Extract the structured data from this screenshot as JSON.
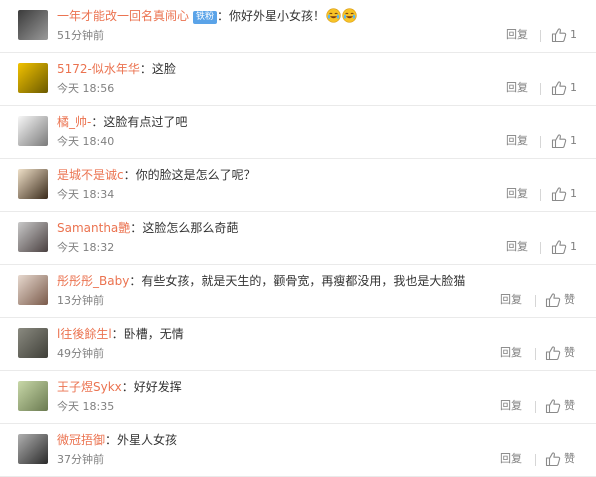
{
  "comments": [
    {
      "user": "一年才能改一回名真闹心",
      "badge": "铁粉",
      "text": "你好外星小女孩！",
      "emojis": [
        "laugh-cry-icon",
        "laugh-cry-icon"
      ],
      "time": "51分钟前",
      "reply": "回复",
      "like": "1",
      "avatar_colors": [
        "#3b3b3b",
        "#9a9a9a"
      ]
    },
    {
      "user": "5172-似水年华",
      "badge": "",
      "text": "这脸",
      "emojis": [],
      "time": "今天 18:56",
      "reply": "回复",
      "like": "1",
      "avatar_colors": [
        "#f2c200",
        "#6b5a00"
      ]
    },
    {
      "user": "橘_帅-",
      "badge": "",
      "text": "这脸有点过了吧",
      "emojis": [],
      "time": "今天 18:40",
      "reply": "回复",
      "like": "1",
      "avatar_colors": [
        "#f7f7f7",
        "#7a7a7a"
      ]
    },
    {
      "user": "是城不是诚c",
      "badge": "",
      "text": "你的脸这是怎么了呢？",
      "emojis": [],
      "time": "今天 18:34",
      "reply": "回复",
      "like": "1",
      "avatar_colors": [
        "#efe0c8",
        "#3a2a1a"
      ]
    },
    {
      "user": "Samantha艷",
      "badge": "",
      "text": "这脸怎么那么奇葩",
      "emojis": [],
      "time": "今天 18:32",
      "reply": "回复",
      "like": "1",
      "avatar_colors": [
        "#c9c9c9",
        "#4a4040"
      ]
    },
    {
      "user": "彤彤彤_Baby",
      "badge": "",
      "text": "有些女孩，就是天生的，颧骨宽，再瘦都没用，我也是大脸猫",
      "emojis": [],
      "time": "13分钟前",
      "reply": "回复",
      "like": "赞",
      "avatar_colors": [
        "#e7d9cf",
        "#7a5a4a"
      ]
    },
    {
      "user": "l往後餘生l",
      "badge": "",
      "text": "卧槽，无情",
      "emojis": [],
      "time": "49分钟前",
      "reply": "回复",
      "like": "赞",
      "avatar_colors": [
        "#8a8a80",
        "#3f3f38"
      ]
    },
    {
      "user": "王子煜Sykx",
      "badge": "",
      "text": "好好发挥",
      "emojis": [],
      "time": "今天 18:35",
      "reply": "回复",
      "like": "赞",
      "avatar_colors": [
        "#c8d8a8",
        "#6a7a50"
      ]
    },
    {
      "user": "微冠捂御",
      "badge": "",
      "text": "外星人女孩",
      "emojis": [],
      "time": "37分钟前",
      "reply": "回复",
      "like": "赞",
      "avatar_colors": [
        "#b0b0b0",
        "#2a2a2a"
      ]
    }
  ],
  "colon": "："
}
